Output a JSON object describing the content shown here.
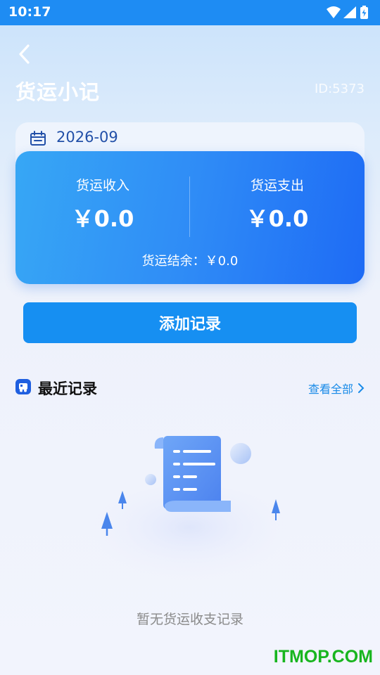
{
  "status_bar": {
    "time": "10:17"
  },
  "header": {
    "title": "货运小记",
    "user_id": "ID:5373"
  },
  "month_selector": {
    "month": "2026-09"
  },
  "summary": {
    "income_label": "货运收入",
    "income_value": "￥0.0",
    "expense_label": "货运支出",
    "expense_value": "￥0.0",
    "balance_text": "货运结余：￥0.0"
  },
  "actions": {
    "add_record_label": "添加记录"
  },
  "recent": {
    "title": "最近记录",
    "view_all_label": "查看全部",
    "empty_text": "暂无货运收支记录"
  },
  "watermark": "ITMOP.COM",
  "colors": {
    "primary": "#168ff2",
    "gradient_start": "#37a7f5",
    "gradient_end": "#1e6bf5"
  }
}
